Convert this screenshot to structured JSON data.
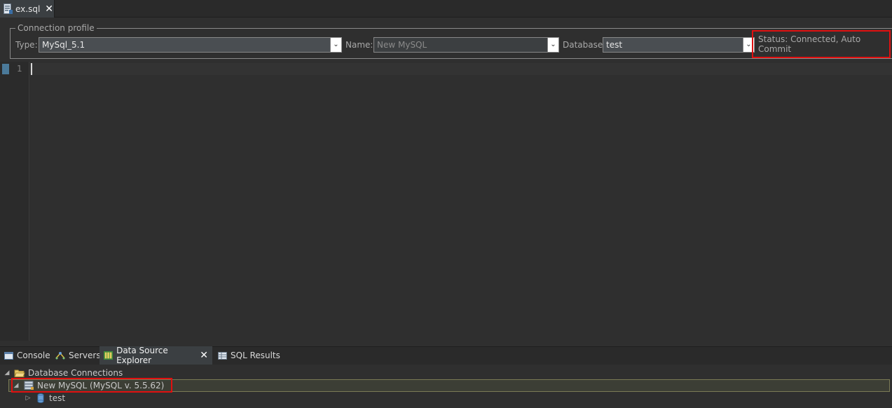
{
  "editor_tab": {
    "label": "ex.sql",
    "close": "✕"
  },
  "profile": {
    "legend": "Connection profile",
    "type_label": "Type:",
    "type_value": "MySql_5.1",
    "name_label": "Name:",
    "name_value": "New MySQL",
    "database_label": "Database:",
    "database_value": "test",
    "status": "Status: Connected, Auto Commit"
  },
  "editor": {
    "line_number": "1"
  },
  "view_tabs": [
    {
      "label": "Console"
    },
    {
      "label": "Servers"
    },
    {
      "label": "Data Source Explorer"
    },
    {
      "label": "SQL Results"
    }
  ],
  "tree": {
    "root_label": "Database Connections",
    "connection_label": "New MySQL (MySQL v. 5.5.62)",
    "db_label": "test"
  },
  "colors": {
    "highlight": "#e01010",
    "background": "#2f2f2f"
  }
}
